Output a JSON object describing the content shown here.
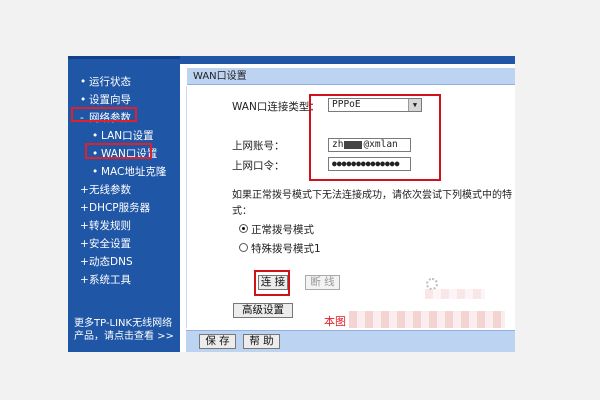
{
  "sidebar": {
    "items": [
      {
        "bullet": "•",
        "label": "运行状态"
      },
      {
        "bullet": "•",
        "label": "设置向导"
      },
      {
        "bullet": "-",
        "label": "网络参数"
      },
      {
        "bullet": "•",
        "label": "LAN口设置"
      },
      {
        "bullet": "•",
        "label": "WAN口设置"
      },
      {
        "bullet": "•",
        "label": "MAC地址克隆"
      },
      {
        "bullet": "+",
        "label": "无线参数"
      },
      {
        "bullet": "+",
        "label": "DHCP服务器"
      },
      {
        "bullet": "+",
        "label": "转发规则"
      },
      {
        "bullet": "+",
        "label": "安全设置"
      },
      {
        "bullet": "+",
        "label": "动态DNS"
      },
      {
        "bullet": "+",
        "label": "系统工具"
      }
    ],
    "footer_line1": "更多TP-LINK无线网络",
    "footer_line2": "产品，请点击查看 >>"
  },
  "panel": {
    "title": "WAN口设置",
    "conn_type_label": "WAN口连接类型：",
    "conn_type_value": "PPPoE",
    "account_label": "上网账号：",
    "account_value": "zh",
    "account_value_tail": "@xmlan",
    "password_label": "上网口令：",
    "password_value": "●●●●●●●●●●●●●●",
    "hint_line1": "如果正常拨号模式下无法连接成功，请依次尝试下列模式中的特",
    "hint_line2": "式：",
    "mode_normal": "正常拨号模式",
    "mode_special": "特殊拨号模式1",
    "connect_button": "连 接",
    "disconnect_button": "断 线",
    "advanced_button": "高级设置",
    "watermark_text": "本图"
  },
  "footer": {
    "save_button": "保 存",
    "help_button": "帮 助"
  },
  "colors": {
    "sidebar_bg": "#1f56a6",
    "title_bar": "#bcd3f2",
    "highlight": "#d0111c"
  }
}
